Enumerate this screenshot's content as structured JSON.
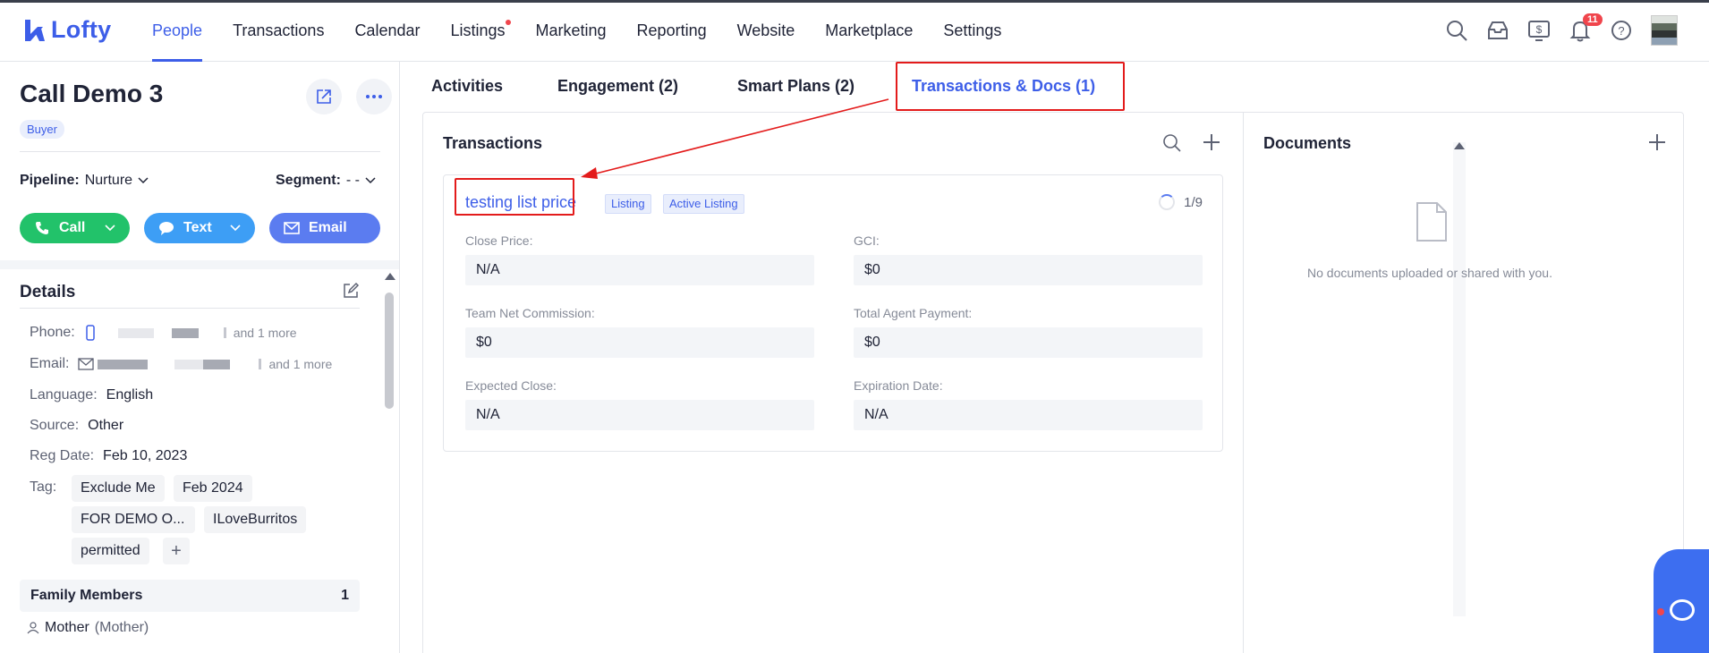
{
  "app": {
    "logo_text": "Lofty",
    "brand_color": "#3d5ee8"
  },
  "nav": {
    "items": [
      {
        "label": "People",
        "active": true
      },
      {
        "label": "Transactions"
      },
      {
        "label": "Calendar"
      },
      {
        "label": "Listings",
        "has_dot": true
      },
      {
        "label": "Marketing"
      },
      {
        "label": "Reporting"
      },
      {
        "label": "Website"
      },
      {
        "label": "Marketplace"
      },
      {
        "label": "Settings"
      }
    ],
    "tools": [
      "search-icon",
      "inbox-icon",
      "dollar-icon",
      "bell-icon",
      "help-icon"
    ],
    "notification_count": "11"
  },
  "contact": {
    "name": "Call Demo 3",
    "role_badge": "Buyer",
    "pipeline_label": "Pipeline:",
    "pipeline_value": "Nurture",
    "segment_label": "Segment:",
    "segment_value": "- -",
    "actions": {
      "call": "Call",
      "text": "Text",
      "email": "Email"
    }
  },
  "details": {
    "heading": "Details",
    "phone_label": "Phone:",
    "phone_more": "and 1 more",
    "email_label": "Email:",
    "email_more": "and 1 more",
    "language_label": "Language:",
    "language_value": "English",
    "source_label": "Source:",
    "source_value": "Other",
    "regdate_label": "Reg Date:",
    "regdate_value": "Feb 10, 2023",
    "tag_label": "Tag:",
    "tags": [
      "Exclude Me",
      "Feb 2024",
      "FOR DEMO O...",
      "ILoveBurritos",
      "permitted"
    ],
    "family_label": "Family Members",
    "family_count": "1",
    "member_name": "Mother",
    "member_relation": "(Mother)"
  },
  "tabs": [
    {
      "label": "Activities"
    },
    {
      "label": "Engagement (2)"
    },
    {
      "label": "Smart Plans (2)"
    },
    {
      "label": "Transactions & Docs (1)",
      "active": true
    }
  ],
  "transactions": {
    "heading": "Transactions",
    "item": {
      "title": "testing list price",
      "chips": [
        "Listing",
        "Active Listing"
      ],
      "progress": "1/9",
      "fields": {
        "close_price_label": "Close Price:",
        "close_price_value": "N/A",
        "gci_label": "GCI:",
        "gci_value": "$0",
        "team_net_label": "Team Net Commission:",
        "team_net_value": "$0",
        "total_agent_label": "Total Agent Payment:",
        "total_agent_value": "$0",
        "expected_close_label": "Expected Close:",
        "expected_close_value": "N/A",
        "expiration_label": "Expiration Date:",
        "expiration_value": "N/A"
      }
    }
  },
  "documents": {
    "heading": "Documents",
    "empty_text": "No documents uploaded or shared with you."
  },
  "colors": {
    "accent": "#3d5ee8",
    "call_green": "#22c26a",
    "text_blue": "#3d9ef5",
    "email_blue": "#5b7cf0",
    "annotation_red": "#e31b1b"
  }
}
